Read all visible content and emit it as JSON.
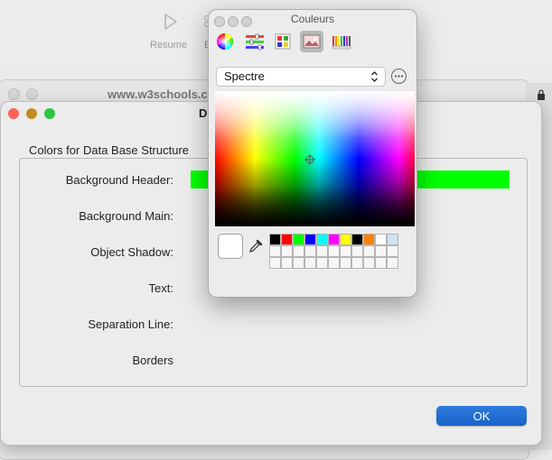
{
  "background_app": {
    "toolbar": {
      "resume_label": "Resume",
      "partial_label": "E"
    },
    "browser": {
      "title": "www.w3schools.c"
    }
  },
  "dialog": {
    "title": "D",
    "group_label": "Colors for Data Base Structure",
    "rows": [
      {
        "label": "Background Header:",
        "color": "#00ff00"
      },
      {
        "label": "Background Main:"
      },
      {
        "label": "Object Shadow:"
      },
      {
        "label": "Text:"
      },
      {
        "label": "Separation Line:"
      },
      {
        "label": "Borders"
      }
    ],
    "ok_label": "OK",
    "traffic_lights": [
      "#ff5f57",
      "#c18b20",
      "#28c840"
    ]
  },
  "color_panel": {
    "title": "Couleurs",
    "modes": [
      {
        "name": "color-wheel-icon",
        "selected": false
      },
      {
        "name": "sliders-icon",
        "selected": false
      },
      {
        "name": "palettes-icon",
        "selected": false
      },
      {
        "name": "image-palettes-icon",
        "selected": true
      },
      {
        "name": "pencils-icon",
        "selected": false
      }
    ],
    "palette_select": {
      "value": "Spectre"
    },
    "current_color": "#ffffff",
    "swatches": [
      "#000000",
      "#ff0000",
      "#00ff00",
      "#0000ff",
      "#00ffff",
      "#ff00ff",
      "#ffff00",
      "#000000",
      "#ff8000",
      "#ffffff",
      "#cfe4ef"
    ],
    "empty_swatch_count": 22
  }
}
